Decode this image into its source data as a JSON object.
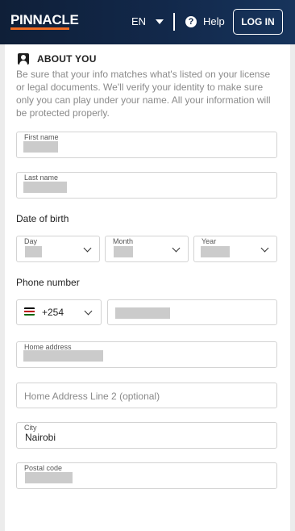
{
  "header": {
    "logo": "PINNACLE",
    "language": "EN",
    "help": "Help",
    "login": "LOG IN",
    "accent_color": "#f26b21"
  },
  "about": {
    "title": "ABOUT YOU",
    "description": "Be sure that your info matches what's listed on your license or legal documents. We'll verify your identity to make sure only you can play under your name. All your information will be protected properly."
  },
  "fields": {
    "first_name_label": "First name",
    "last_name_label": "Last name",
    "dob_label": "Date of birth",
    "day_label": "Day",
    "month_label": "Month",
    "year_label": "Year",
    "phone_label": "Phone number",
    "phone_code": "+254",
    "home_address_label": "Home address",
    "address_line2_placeholder": "Home Address Line 2 (optional)",
    "city_label": "City",
    "city_value": "Nairobi",
    "postal_code_label": "Postal code"
  }
}
